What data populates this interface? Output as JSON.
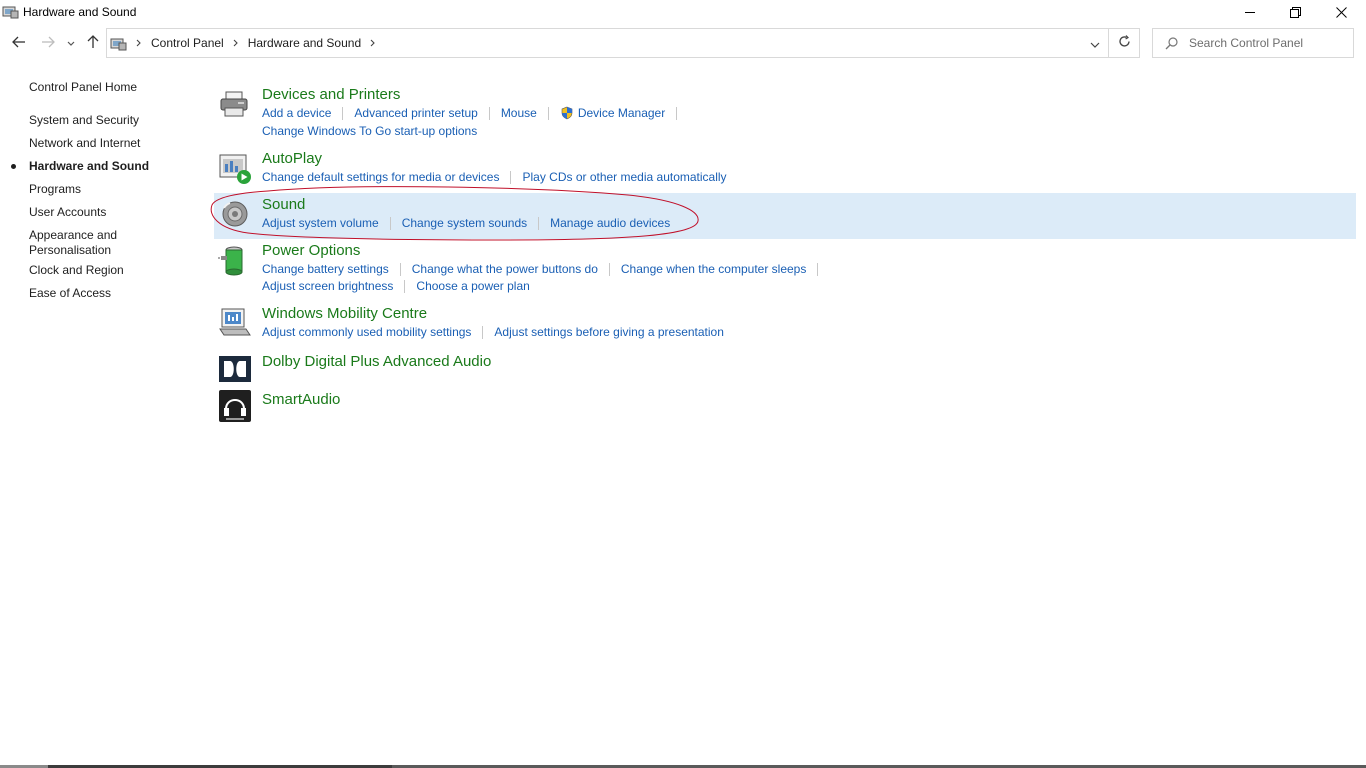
{
  "window": {
    "title": "Hardware and Sound"
  },
  "address": {
    "crumbs": [
      "Control Panel",
      "Hardware and Sound"
    ],
    "search_placeholder": "Search Control Panel"
  },
  "sidebar": {
    "items": [
      {
        "label": "Control Panel Home"
      },
      {
        "label": "System and Security"
      },
      {
        "label": "Network and Internet"
      },
      {
        "label": "Hardware and Sound",
        "active": true
      },
      {
        "label": "Programs"
      },
      {
        "label": "User Accounts"
      },
      {
        "label": "Appearance and"
      },
      {
        "label": "Personalisation"
      },
      {
        "label": "Clock and Region"
      },
      {
        "label": "Ease of Access"
      }
    ]
  },
  "categories": {
    "devices": {
      "title": "Devices and Printers",
      "links": [
        "Add a device",
        "Advanced printer setup",
        "Mouse",
        "Device Manager"
      ],
      "links2": [
        "Change Windows To Go start-up options"
      ]
    },
    "autoplay": {
      "title": "AutoPlay",
      "links": [
        "Change default settings for media or devices",
        "Play CDs or other media automatically"
      ]
    },
    "sound": {
      "title": "Sound",
      "links": [
        "Adjust system volume",
        "Change system sounds",
        "Manage audio devices"
      ]
    },
    "power": {
      "title": "Power Options",
      "links": [
        "Change battery settings",
        "Change what the power buttons do",
        "Change when the computer sleeps"
      ],
      "links2": [
        "Adjust screen brightness",
        "Choose a power plan"
      ]
    },
    "mobility": {
      "title": "Windows Mobility Centre",
      "links": [
        "Adjust commonly used mobility settings",
        "Adjust settings before giving a presentation"
      ]
    },
    "dolby": {
      "title": "Dolby Digital Plus Advanced Audio"
    },
    "smartaudio": {
      "title": "SmartAudio"
    }
  },
  "colors": {
    "category_title": "#1a7a1a",
    "link": "#1a5fb4",
    "highlight": "#dcebf8",
    "annotation": "#c0102a"
  },
  "icons": {
    "back": "back-arrow-icon",
    "forward": "forward-arrow-icon",
    "up": "up-arrow-icon",
    "refresh": "refresh-icon",
    "search": "search-icon",
    "shield": "uac-shield-icon"
  }
}
